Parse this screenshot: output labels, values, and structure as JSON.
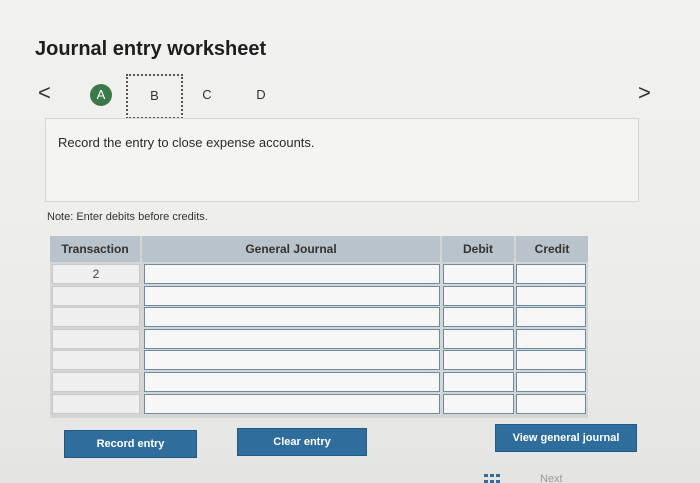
{
  "page": {
    "title": "Journal entry worksheet",
    "nav_prev": "<",
    "nav_next": ">"
  },
  "steps": [
    {
      "label": "A",
      "state": "completed"
    },
    {
      "label": "B",
      "state": "current"
    },
    {
      "label": "C",
      "state": "pending"
    },
    {
      "label": "D",
      "state": "pending"
    }
  ],
  "instruction": "Record the entry to close expense accounts.",
  "note": "Note: Enter debits before credits.",
  "journal": {
    "headers": {
      "transaction": "Transaction",
      "general_journal": "General Journal",
      "debit": "Debit",
      "credit": "Credit"
    },
    "rows": [
      {
        "transaction": "2",
        "account": "",
        "debit": "",
        "credit": ""
      },
      {
        "transaction": "",
        "account": "",
        "debit": "",
        "credit": ""
      },
      {
        "transaction": "",
        "account": "",
        "debit": "",
        "credit": ""
      },
      {
        "transaction": "",
        "account": "",
        "debit": "",
        "credit": ""
      },
      {
        "transaction": "",
        "account": "",
        "debit": "",
        "credit": ""
      },
      {
        "transaction": "",
        "account": "",
        "debit": "",
        "credit": ""
      },
      {
        "transaction": "",
        "account": "",
        "debit": "",
        "credit": ""
      }
    ]
  },
  "buttons": {
    "record": "Record entry",
    "clear": "Clear entry",
    "view": "View general journal"
  },
  "footer": {
    "next_label": "Next"
  },
  "colors": {
    "step_completed": "#3a7a4a",
    "button": "#2f6e9c",
    "header": "#b9c3cc"
  }
}
